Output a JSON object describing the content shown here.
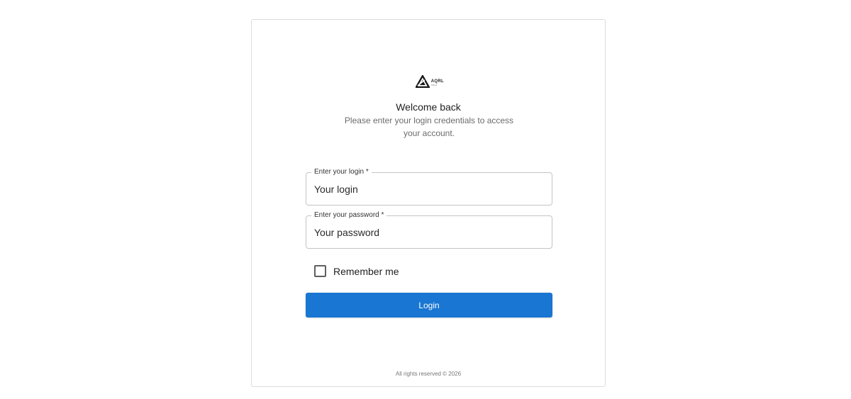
{
  "brand": {
    "logo_name": "AQRL",
    "logo_sub": "TECH",
    "logo_icon": "triangle-logo-icon"
  },
  "header": {
    "title": "Welcome back",
    "subtitle": "Please enter your login credentials to access your account."
  },
  "form": {
    "login": {
      "label": "Enter your login *",
      "placeholder": "Your login",
      "value": ""
    },
    "password": {
      "label": "Enter your password *",
      "placeholder": "Your password",
      "value": ""
    },
    "remember_me": {
      "label": "Remember me",
      "checked": false
    },
    "submit_label": "Login"
  },
  "footer": {
    "text": "All rights reserved © 2026"
  },
  "colors": {
    "primary": "#1976d2",
    "border": "#c4c4c4",
    "muted_text": "#6b6b6b"
  }
}
